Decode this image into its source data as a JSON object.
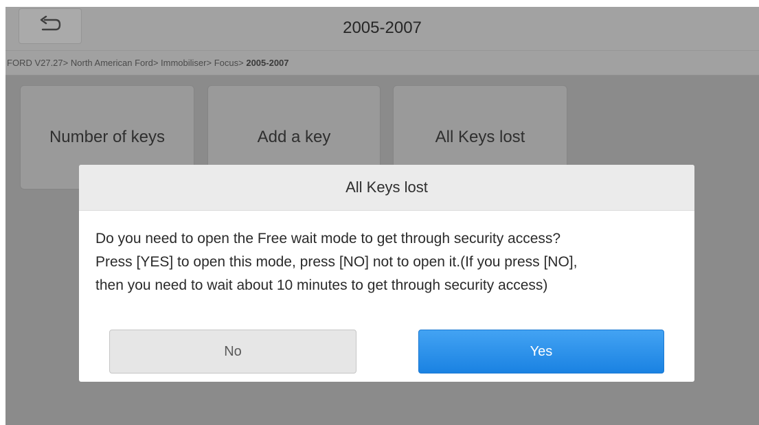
{
  "header": {
    "title": "2005-2007",
    "back_icon": "back-arrow-icon"
  },
  "breadcrumb": {
    "items": [
      "FORD V27.27",
      "North American Ford",
      "Immobiliser",
      "Focus"
    ],
    "separator": ">",
    "current": "2005-2007"
  },
  "functions": [
    {
      "label": "Number of keys"
    },
    {
      "label": "Add a key"
    },
    {
      "label": "All Keys lost"
    }
  ],
  "dialog": {
    "title": "All Keys lost",
    "lines": [
      "Do you need to open the Free wait mode to get through security access?",
      "Press [YES] to open this mode, press [NO] not to open it.(If you press [NO],",
      "then you need to wait about 10 minutes to get through security access)"
    ],
    "no_label": "No",
    "yes_label": "Yes"
  },
  "colors": {
    "accent": "#2a8fe8",
    "dim_background": "#8b8b8b"
  }
}
